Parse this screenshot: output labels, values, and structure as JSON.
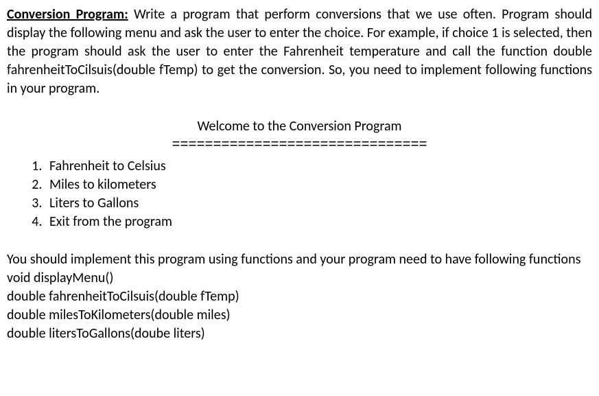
{
  "heading_label": "Conversion Program:",
  "intro_text": " Write a program that perform conversions that we use often. Program should display the following menu and ask the user to enter the choice. For example, if choice 1 is selected, then the program should ask the user to enter the Fahrenheit temperature and call the function double fahrenheitToCilsuis(double fTemp) to get the conversion. So, you need to implement following functions in your program.",
  "menu": {
    "title": "Welcome to the Conversion Program",
    "separator": "===============================",
    "items": [
      "Fahrenheit to Celsius",
      "Miles to kilometers",
      "Liters to Gallons",
      "Exit from the program"
    ]
  },
  "requirements": {
    "lead": "You should implement this program using functions and your program need to have following functions",
    "functions": [
      "void displayMenu()",
      "double fahrenheitToCilsuis(double fTemp)",
      "double milesToKilometers(double miles)",
      "double litersToGallons(doube liters)"
    ]
  }
}
